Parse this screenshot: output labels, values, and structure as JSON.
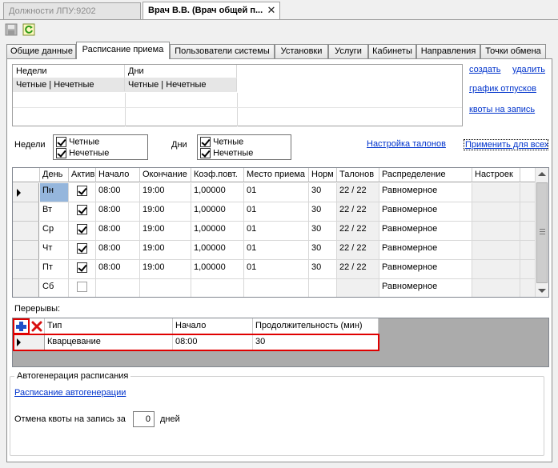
{
  "window_tabs": [
    {
      "label": "Должности ЛПУ:9202"
    },
    {
      "label": "Врач В.В. (Врач общей п..."
    }
  ],
  "toolbar": {
    "save_icon": "save-icon",
    "refresh_icon": "refresh-icon"
  },
  "tabs": [
    {
      "label": "Общие данные"
    },
    {
      "label": "Расписание приема"
    },
    {
      "label": "Пользователи системы"
    },
    {
      "label": "Установки"
    },
    {
      "label": "Услуги"
    },
    {
      "label": "Кабинеты"
    },
    {
      "label": "Направления"
    },
    {
      "label": "Точки обмена"
    }
  ],
  "summary_grid": {
    "headers": [
      "Недели",
      "Дни"
    ],
    "row": [
      "Четные | Нечетные",
      "Четные | Нечетные"
    ]
  },
  "side_links": {
    "create": "создать",
    "delete": "удалить",
    "vacation": "график отпусков",
    "quotas": "квоты на запись"
  },
  "filters": {
    "weeks_label": "Недели",
    "weeks": [
      {
        "label": "Четные",
        "checked": true
      },
      {
        "label": "Нечетные",
        "checked": true
      }
    ],
    "days_label": "Дни",
    "days": [
      {
        "label": "Четные",
        "checked": true
      },
      {
        "label": "Нечетные",
        "checked": true
      }
    ],
    "coupon_settings_link": "Настройка талонов",
    "apply_all_link": "Применить для всех"
  },
  "schedule": {
    "columns": [
      "День",
      "Актив",
      "Начало",
      "Окончание",
      "Коэф.повт.",
      "Место приема",
      "Норм",
      "Талонов",
      "Распределение",
      "Настроек"
    ],
    "rows": [
      {
        "day": "Пн",
        "active": true,
        "start": "08:00",
        "end": "19:00",
        "coef": "1,00000",
        "place": "01",
        "norm": "30",
        "tickets": "22 / 22",
        "distribution": "Равномерное",
        "current": true
      },
      {
        "day": "Вт",
        "active": true,
        "start": "08:00",
        "end": "19:00",
        "coef": "1,00000",
        "place": "01",
        "norm": "30",
        "tickets": "22 / 22",
        "distribution": "Равномерное",
        "current": false
      },
      {
        "day": "Ср",
        "active": true,
        "start": "08:00",
        "end": "19:00",
        "coef": "1,00000",
        "place": "01",
        "norm": "30",
        "tickets": "22 / 22",
        "distribution": "Равномерное",
        "current": false
      },
      {
        "day": "Чт",
        "active": true,
        "start": "08:00",
        "end": "19:00",
        "coef": "1,00000",
        "place": "01",
        "norm": "30",
        "tickets": "22 / 22",
        "distribution": "Равномерное",
        "current": false
      },
      {
        "day": "Пт",
        "active": true,
        "start": "08:00",
        "end": "19:00",
        "coef": "1,00000",
        "place": "01",
        "norm": "30",
        "tickets": "22 / 22",
        "distribution": "Равномерное",
        "current": false
      },
      {
        "day": "Сб",
        "active": false,
        "start": "",
        "end": "",
        "coef": "",
        "place": "",
        "norm": "",
        "tickets": "",
        "distribution": "Равномерное",
        "current": false
      }
    ]
  },
  "breaks": {
    "label": "Перерывы:",
    "columns": [
      "Тип",
      "Начало",
      "Продолжительность (мин)"
    ],
    "rows": [
      {
        "type": "Кварцевание",
        "start": "08:00",
        "duration": "30"
      }
    ],
    "highlight_color": "#e00000"
  },
  "autogen": {
    "group_label": "Автогенерация расписания",
    "link": "Расписание автогенерации",
    "cancel_label": "Отмена квоты на запись за",
    "cancel_value": "0",
    "cancel_unit": "дней"
  }
}
